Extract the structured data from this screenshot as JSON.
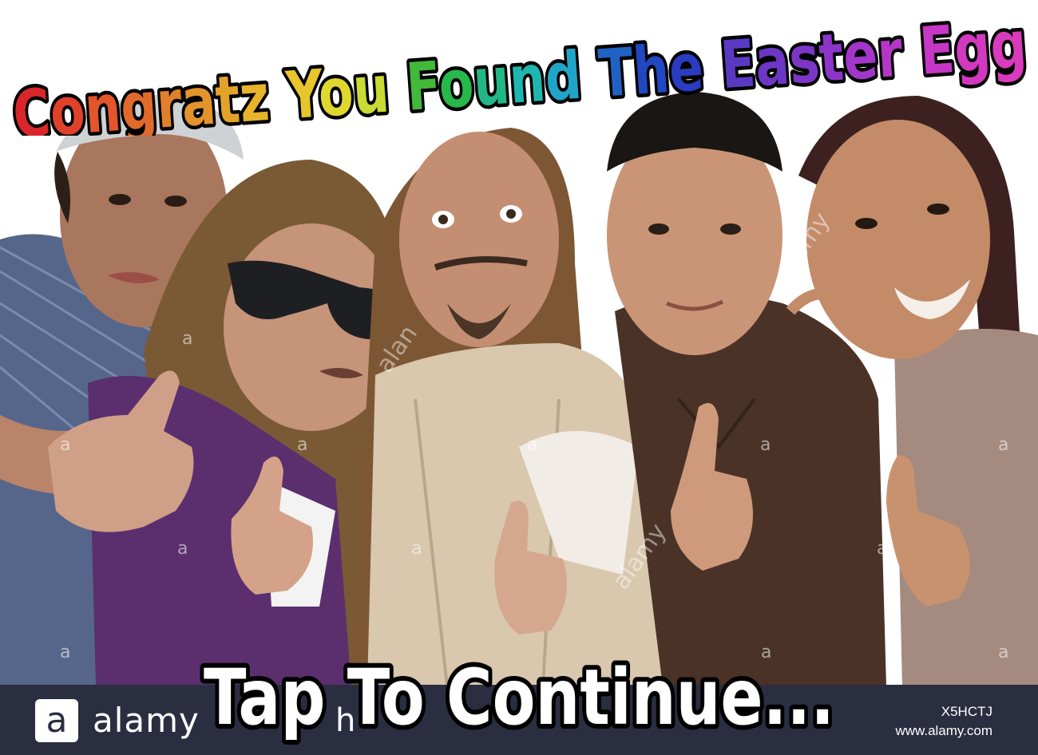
{
  "headline": {
    "words": [
      {
        "text": "Congratz",
        "colors": [
          "#d9262b",
          "#e0412a",
          "#e3562b",
          "#e16a2b",
          "#e27f2b",
          "#e2932b",
          "#e3a32b",
          "#e8b42c"
        ]
      },
      {
        "text": "You",
        "colors": [
          "#e6c62c",
          "#e0d72e",
          "#c8da33"
        ]
      },
      {
        "text": "Found",
        "colors": [
          "#42b93a",
          "#27b84a",
          "#21b787",
          "#1fb6b0",
          "#20a5c8"
        ]
      },
      {
        "text": "The",
        "colors": [
          "#1f62c4",
          "#2147c1",
          "#2a3cc0"
        ]
      },
      {
        "text": "Easter",
        "colors": [
          "#5a39c2",
          "#6b37c4",
          "#7c36c6",
          "#8d35c8",
          "#a236c9",
          "#b636c8"
        ]
      },
      {
        "text": "Egg",
        "colors": [
          "#c637c6",
          "#d139c0",
          "#d83bbb"
        ]
      }
    ]
  },
  "prompt": {
    "continue_label": "Tap To Continue..."
  },
  "watermark": {
    "small_letter": "a",
    "diagonal_1": "alan",
    "diagonal_2": "alamy",
    "diagonal_3": "alamy"
  },
  "bottom_bar": {
    "logo_letter": "a",
    "logo_text": "alamy",
    "partial_text": "h",
    "image_id": "X5HCTJ",
    "site_url": "www.alamy.com",
    "background": "#2b2e40"
  }
}
